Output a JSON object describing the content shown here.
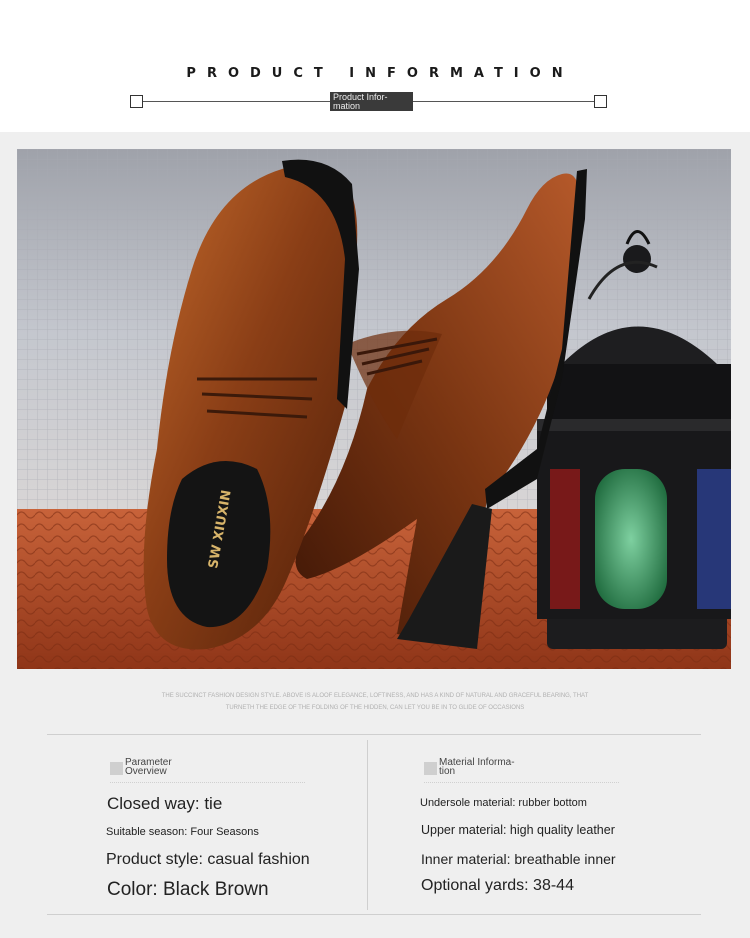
{
  "header": {
    "title": "PRODUCT INFORMATION",
    "tag": "Product Infor- mation"
  },
  "caption": {
    "line1": "THE SUCCINCT FASHION DESIGN STYLE. ABOVE IS ALOOF ELEGANCE, LOFTINESS, AND HAS A KIND OF NATURAL AND GRACEFUL BEARING, THAT",
    "line2": "TURNETH THE EDGE OF THE FOLDING OF THE HIDDEN, CAN LET YOU BE IN TO GLIDE OF OCCASIONS"
  },
  "insole_brand": "SW XIUXIN",
  "parameters": {
    "heading": "Parameter Overview",
    "items": [
      "Closed way: tie",
      "Suitable season: Four Seasons",
      "Product style: casual fashion",
      "Color: Black Brown"
    ]
  },
  "material": {
    "heading": "Material Informa- tion",
    "items": [
      "Undersole material: rubber bottom",
      "Upper material: high quality leather",
      "Inner material: breathable inner",
      "Optional yards: 38-44"
    ]
  },
  "colors": {
    "leather": "#7a3512",
    "floor": "#b04a24",
    "wall": "#b9bcc4"
  }
}
